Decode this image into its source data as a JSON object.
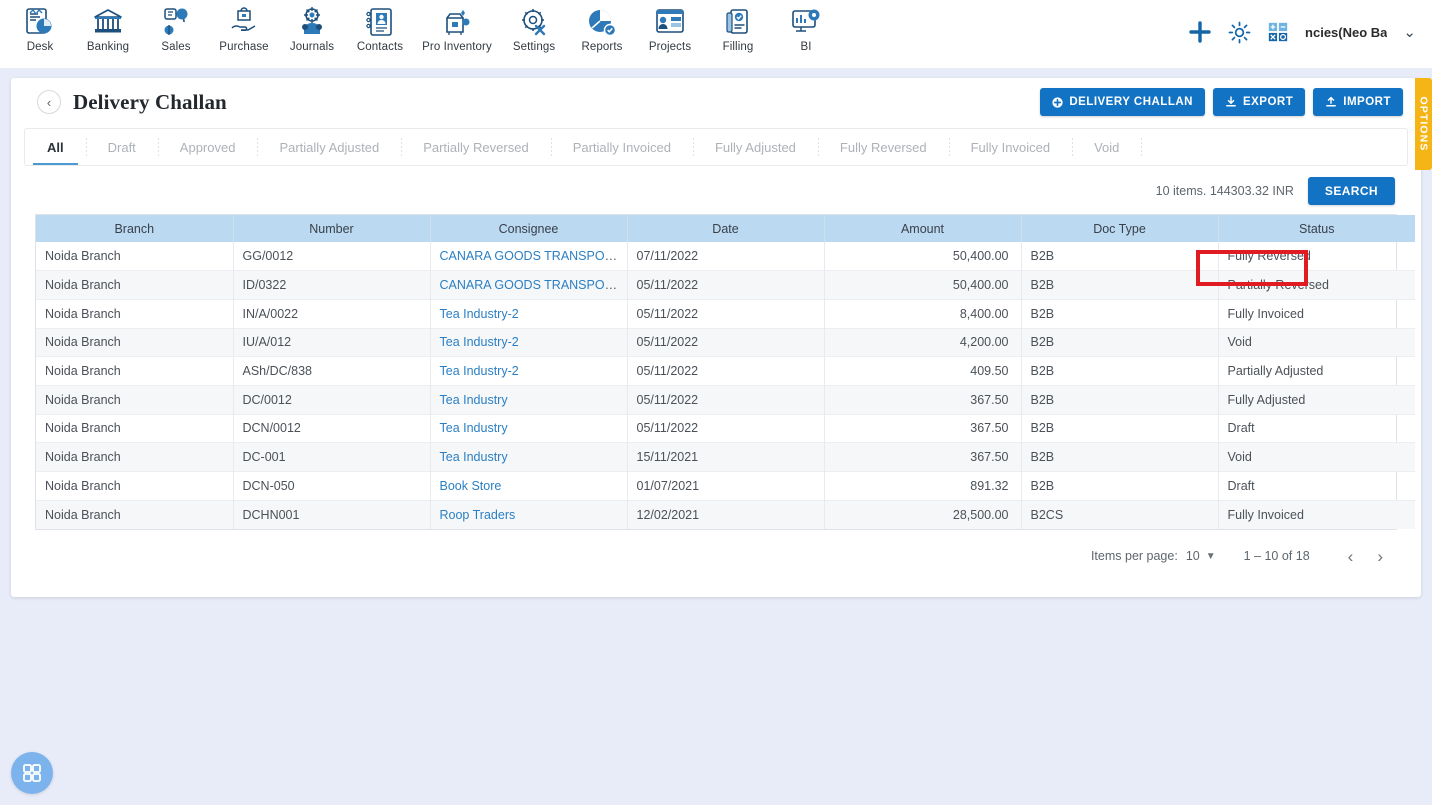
{
  "topnav": {
    "items": [
      {
        "label": "Desk",
        "icon": "desk-icon"
      },
      {
        "label": "Banking",
        "icon": "bank-icon"
      },
      {
        "label": "Sales",
        "icon": "sales-icon"
      },
      {
        "label": "Purchase",
        "icon": "purchase-icon"
      },
      {
        "label": "Journals",
        "icon": "journals-icon"
      },
      {
        "label": "Contacts",
        "icon": "contacts-icon"
      },
      {
        "label": "Pro Inventory",
        "icon": "inventory-icon"
      },
      {
        "label": "Settings",
        "icon": "settings-icon"
      },
      {
        "label": "Reports",
        "icon": "reports-icon"
      },
      {
        "label": "Projects",
        "icon": "projects-icon"
      },
      {
        "label": "Filling",
        "icon": "filling-icon"
      },
      {
        "label": "BI",
        "icon": "bi-icon"
      }
    ],
    "right": {
      "add_icon": "plus-icon",
      "settings_icon": "gear-icon",
      "calculator_icon": "calculator-icon",
      "company": "ncies(Neo Ba",
      "chevron": "chevron-down-icon"
    }
  },
  "page": {
    "title": "Delivery Challan",
    "back_icon": "chevron-left-icon"
  },
  "actions": {
    "create_label": "DELIVERY CHALLAN",
    "create_icon": "plus-circle-icon",
    "export_label": "EXPORT",
    "export_icon": "download-icon",
    "import_label": "IMPORT",
    "import_icon": "upload-icon"
  },
  "options_tab": {
    "label": "OPTIONS"
  },
  "tabs": [
    {
      "label": "All",
      "active": true
    },
    {
      "label": "Draft",
      "active": false
    },
    {
      "label": "Approved",
      "active": false
    },
    {
      "label": "Partially Adjusted",
      "active": false
    },
    {
      "label": "Partially Reversed",
      "active": false
    },
    {
      "label": "Partially Invoiced",
      "active": false
    },
    {
      "label": "Fully Adjusted",
      "active": false
    },
    {
      "label": "Fully Reversed",
      "active": false
    },
    {
      "label": "Fully Invoiced",
      "active": false
    },
    {
      "label": "Void",
      "active": false
    }
  ],
  "summary": {
    "text": "10 items. 144303.32 INR",
    "search_label": "SEARCH"
  },
  "table": {
    "columns": [
      "Branch",
      "Number",
      "Consignee",
      "Date",
      "Amount",
      "Doc Type",
      "Status"
    ],
    "rows": [
      {
        "branch": "Noida Branch",
        "number": "GG/0012",
        "consignee": "CANARA GOODS TRANSPORT",
        "date": "07/11/2022",
        "amount": "50,400.00",
        "doc_type": "B2B",
        "status": "Fully Reversed"
      },
      {
        "branch": "Noida Branch",
        "number": "ID/0322",
        "consignee": "CANARA GOODS TRANSPORT",
        "date": "05/11/2022",
        "amount": "50,400.00",
        "doc_type": "B2B",
        "status": "Partially Reversed"
      },
      {
        "branch": "Noida Branch",
        "number": "IN/A/0022",
        "consignee": "Tea Industry-2",
        "date": "05/11/2022",
        "amount": "8,400.00",
        "doc_type": "B2B",
        "status": "Fully Invoiced"
      },
      {
        "branch": "Noida Branch",
        "number": "IU/A/012",
        "consignee": "Tea Industry-2",
        "date": "05/11/2022",
        "amount": "4,200.00",
        "doc_type": "B2B",
        "status": "Void"
      },
      {
        "branch": "Noida Branch",
        "number": "ASh/DC/838",
        "consignee": "Tea Industry-2",
        "date": "05/11/2022",
        "amount": "409.50",
        "doc_type": "B2B",
        "status": "Partially Adjusted"
      },
      {
        "branch": "Noida Branch",
        "number": "DC/0012",
        "consignee": "Tea Industry",
        "date": "05/11/2022",
        "amount": "367.50",
        "doc_type": "B2B",
        "status": "Fully Adjusted"
      },
      {
        "branch": "Noida Branch",
        "number": "DCN/0012",
        "consignee": "Tea Industry",
        "date": "05/11/2022",
        "amount": "367.50",
        "doc_type": "B2B",
        "status": "Draft"
      },
      {
        "branch": "Noida Branch",
        "number": "DC-001",
        "consignee": "Tea Industry",
        "date": "15/11/2021",
        "amount": "367.50",
        "doc_type": "B2B",
        "status": "Void"
      },
      {
        "branch": "Noida Branch",
        "number": "DCN-050",
        "consignee": "Book Store",
        "date": "01/07/2021",
        "amount": "891.32",
        "doc_type": "B2B",
        "status": "Draft"
      },
      {
        "branch": "Noida Branch",
        "number": "DCHN001",
        "consignee": "Roop Traders",
        "date": "12/02/2021",
        "amount": "28,500.00",
        "doc_type": "B2CS",
        "status": "Fully Invoiced"
      }
    ]
  },
  "paginator": {
    "items_per_page_label": "Items per page:",
    "page_size": "10",
    "caret": "▼",
    "range": "1 – 10 of 18",
    "prev_icon": "chevron-left-icon",
    "next_icon": "chevron-right-icon"
  },
  "fab": {
    "icon": "grid-apps-icon"
  },
  "colors": {
    "accent_blue": "#1273c4",
    "table_header": "#bcd9f2",
    "link": "#2a7fc4",
    "highlight_red": "#e01b22",
    "options_orange": "#f5b517",
    "page_bg": "#e7ecf8"
  }
}
